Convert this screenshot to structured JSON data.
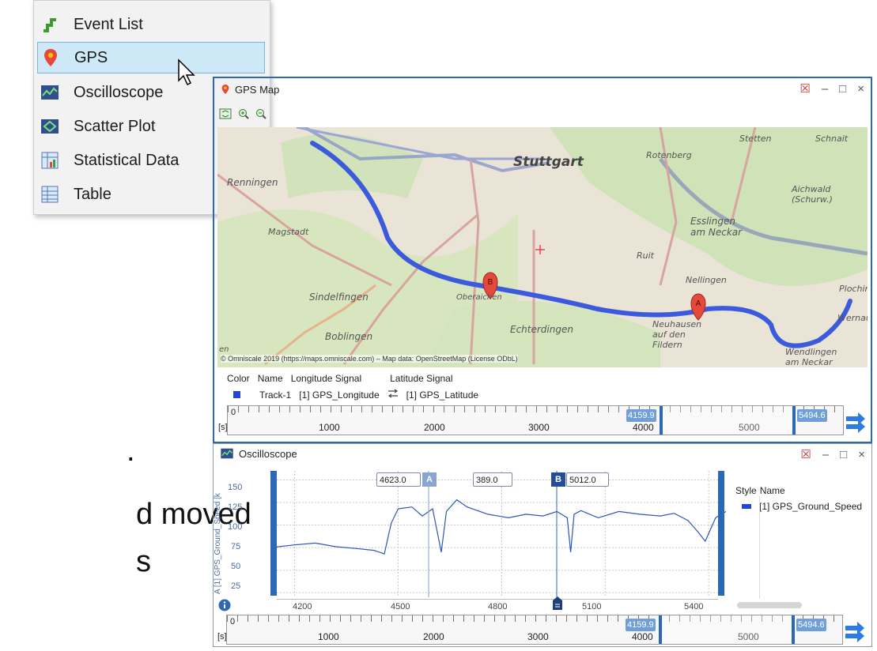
{
  "menu": {
    "items": [
      {
        "label": "Event List",
        "icon": "event-list-icon"
      },
      {
        "label": "GPS",
        "icon": "gps-pin-icon",
        "selected": true
      },
      {
        "label": "Oscilloscope",
        "icon": "oscilloscope-icon"
      },
      {
        "label": "Scatter Plot",
        "icon": "scatter-plot-icon"
      },
      {
        "label": "Statistical Data",
        "icon": "statistical-data-icon"
      },
      {
        "label": "Table",
        "icon": "table-icon"
      }
    ]
  },
  "slide_text": {
    "line1": ".",
    "line2": "d moved",
    "line3": "s"
  },
  "gps": {
    "title": "GPS Map",
    "controls": {
      "help": "☒",
      "minimize": "–",
      "maximize": "□",
      "close": "×"
    },
    "map": {
      "places": [
        "Stuttgart",
        "Rotenberg",
        "Stetten",
        "Schnait",
        "Renningen",
        "Aichwald (Schurw.)",
        "Magstadt",
        "Esslingen am Neckar",
        "Ruit",
        "Nellingen",
        "Sindelfingen",
        "Oberaichen",
        "Echterdingen",
        "Neuhausen auf den Fildern",
        "Plochinger",
        "Wernau",
        "Boblingen",
        "Wendlingen am Neckar",
        "en"
      ],
      "markers": {
        "a": "A",
        "b": "B"
      },
      "attribution": "© Omniscale 2019 (https://maps.omniscale.com) – Map data: OpenStreetMap (License ODbL)"
    },
    "table": {
      "headers": [
        "Color",
        "Name",
        "Longitude Signal",
        "Latitude Signal"
      ],
      "row": {
        "name": "Track-1",
        "longitude": "[1] GPS_Longitude",
        "latitude": "[1] GPS_Latitude"
      }
    },
    "timeline": {
      "unit": "[s]",
      "labels": [
        "0",
        "1000",
        "2000",
        "3000",
        "4000",
        "5000"
      ],
      "range_start": "4159.9",
      "range_end": "5494.6"
    }
  },
  "osc": {
    "title": "Oscilloscope",
    "y_axis_label": "A [1] GPS_Ground_Speed [k",
    "y_ticks": [
      "150",
      "125",
      "100",
      "75",
      "50",
      "25"
    ],
    "x_ticks": [
      "4200",
      "4500",
      "4800",
      "5100",
      "5400"
    ],
    "cursor_a_value": "4623.0",
    "cursor_delta": "389.0",
    "cursor_b_value": "5012.0",
    "cursor_a_label": "A",
    "cursor_b_label": "B",
    "legend": {
      "style_header": "Style",
      "name_header": "Name",
      "entry": "[1] GPS_Ground_Speed"
    },
    "timeline": {
      "unit": "[s]",
      "labels": [
        "0",
        "1000",
        "2000",
        "3000",
        "4000",
        "5000"
      ],
      "range_start": "4159.9",
      "range_end": "5494.6"
    }
  },
  "colors": {
    "accent": "#2d68b5",
    "track": "#3b5bdc",
    "selection": "#cde8f7",
    "signal": "#2c56b8"
  },
  "chart_data": {
    "type": "line",
    "title": "",
    "xlabel": "",
    "ylabel": "[1] GPS_Ground_Speed",
    "xlim": [
      4130,
      5450
    ],
    "ylim": [
      20,
      160
    ],
    "series": [
      {
        "name": "[1] GPS_Ground_Speed",
        "x": [
          4130,
          4200,
          4260,
          4320,
          4380,
          4430,
          4460,
          4480,
          4500,
          4540,
          4570,
          4600,
          4625,
          4640,
          4670,
          4700,
          4760,
          4820,
          4870,
          4920,
          4960,
          4990,
          5000,
          5010,
          5030,
          5080,
          5140,
          5200,
          5260,
          5300,
          5340,
          5370,
          5390,
          5420,
          5450
        ],
        "y": [
          75,
          78,
          80,
          76,
          74,
          72,
          68,
          102,
          118,
          120,
          110,
          118,
          70,
          115,
          128,
          120,
          112,
          108,
          112,
          110,
          115,
          108,
          70,
          112,
          116,
          108,
          115,
          112,
          110,
          113,
          105,
          92,
          82,
          108,
          115
        ]
      }
    ]
  }
}
